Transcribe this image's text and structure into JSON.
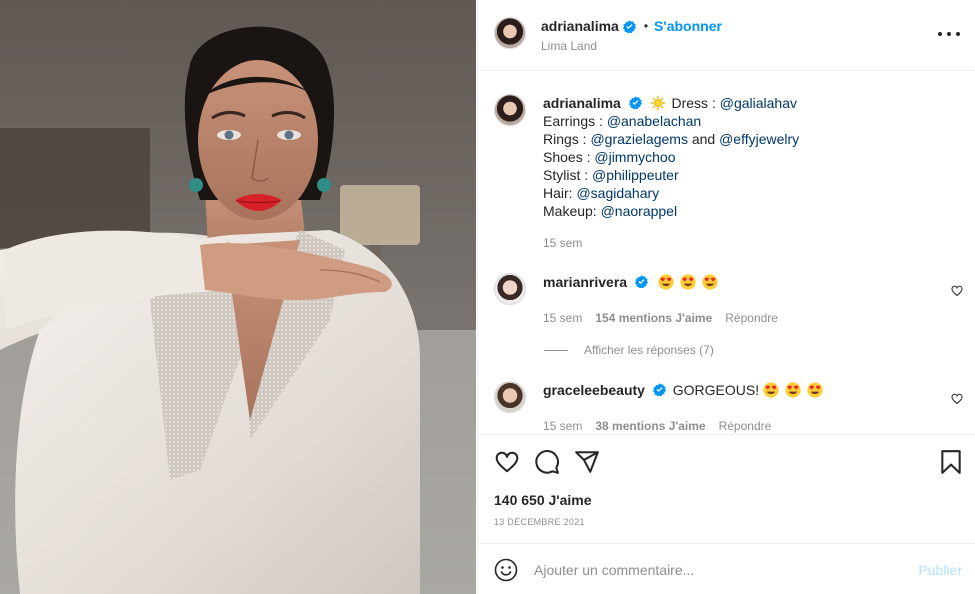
{
  "post_author": {
    "username": "adrianalima",
    "follow_label": "S'abonner",
    "separator": "•",
    "location": "Lima Land"
  },
  "caption": {
    "username": "adrianalima",
    "lines": [
      {
        "label": "Dress : ",
        "mention": "@galialahav"
      },
      {
        "label": "Earrings : ",
        "mention": "@anabelachan"
      },
      {
        "label": "Rings : ",
        "mention": "@grazielagems",
        "joiner": " and ",
        "mention2": "@effyjewelry"
      },
      {
        "label": "Shoes : ",
        "mention": "@jimmychoo"
      },
      {
        "label": "Stylist : ",
        "mention": "@philippeuter"
      },
      {
        "label": "Hair: ",
        "mention": "@sagidahary"
      },
      {
        "label": "Makeup: ",
        "mention": "@naorappel"
      }
    ],
    "time": "15 sem"
  },
  "comments": [
    {
      "username": "marianrivera",
      "text": "",
      "emoji": "heart-eyes-emoji x3",
      "time": "15 sem",
      "likes": "154 mentions J'aime",
      "reply": "Répondre",
      "view_replies": "Afficher les réponses (7)"
    },
    {
      "username": "graceleebeauty",
      "text": "GORGEOUS!",
      "emoji": "heart-eyes-emoji x3",
      "time": "15 sem",
      "likes": "38 mentions J'aime",
      "reply": "Répondre"
    }
  ],
  "actions": {
    "likes_count": "140 650 J'aime",
    "date": "13 DÉCEMBRE 2021"
  },
  "composer": {
    "placeholder": "Ajouter un commentaire...",
    "publish_label": "Publier"
  },
  "colors": {
    "accent": "#0095f6",
    "mention": "#00376b",
    "secondary_text": "#8e8e8e",
    "publish_disabled": "#b2dffc",
    "verified": "#0095f6",
    "lipstick": "#d7212a"
  },
  "icons": [
    "more-options-icon",
    "verified-badge-icon",
    "sun-emoji",
    "heart-eyes-emoji",
    "comment-like-heart-icon",
    "like-icon",
    "comment-icon",
    "share-icon",
    "save-bookmark-icon",
    "emoji-smile-icon"
  ]
}
